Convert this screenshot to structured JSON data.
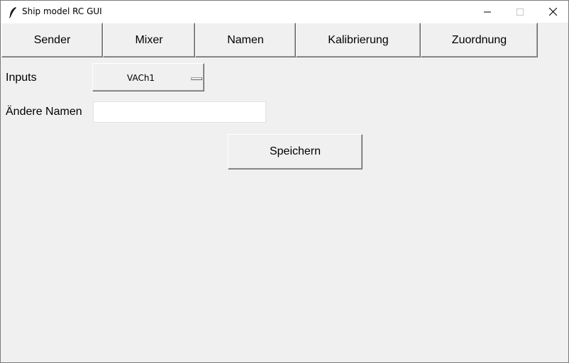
{
  "window": {
    "title": "Ship model RC GUI",
    "icon": "feather-icon",
    "controls": [
      "minimize-icon",
      "maximize-icon",
      "close-icon"
    ]
  },
  "tabs": [
    {
      "label": "Sender"
    },
    {
      "label": "Mixer"
    },
    {
      "label": "Namen"
    },
    {
      "label": "Kalibrierung"
    },
    {
      "label": "Zuordnung"
    }
  ],
  "form": {
    "inputs_label": "Inputs",
    "inputs_selected": "VACh1",
    "rename_label": "Ändere Namen",
    "rename_value": "",
    "save_label": "Speichern"
  },
  "colors": {
    "background": "#f0f0f0",
    "titlebar": "#ffffff",
    "button_shadow": "#696969"
  }
}
